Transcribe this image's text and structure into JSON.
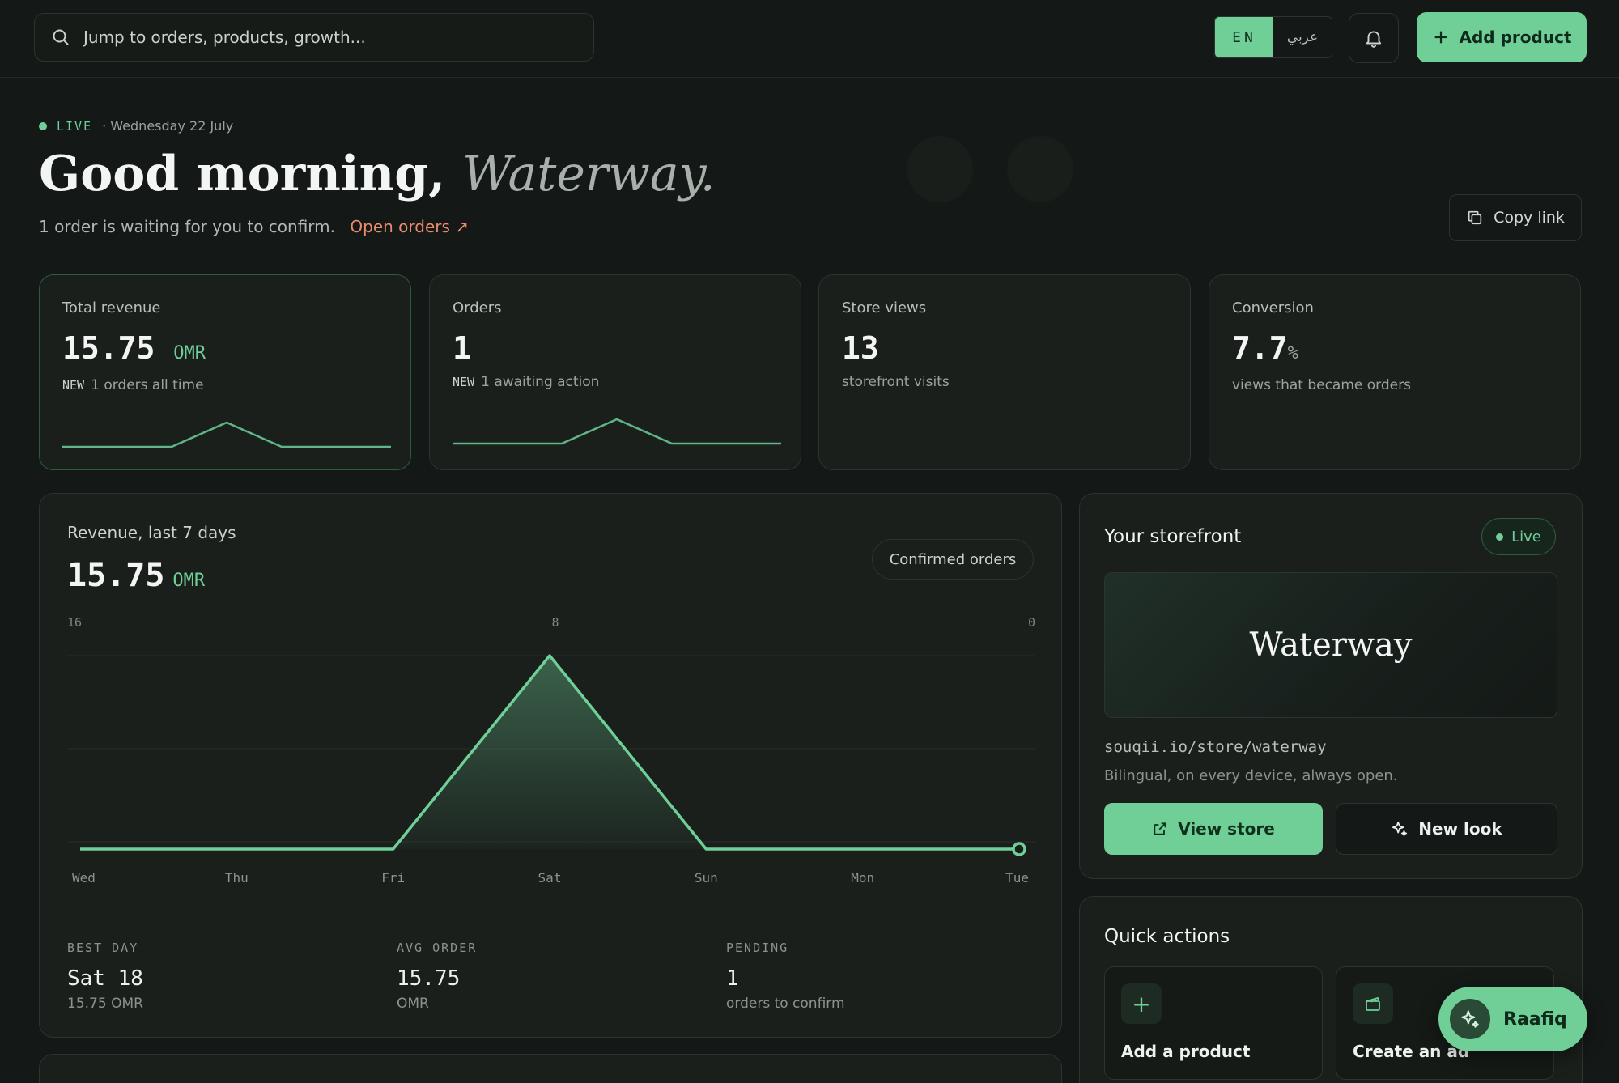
{
  "search": {
    "placeholder": "Jump to orders, products, growth..."
  },
  "lang": {
    "en": "EN",
    "ar": "عربي"
  },
  "topbar": {
    "add_product": "Add product"
  },
  "header": {
    "live": "LIVE",
    "date": "· Wednesday 22 July",
    "greeting_prefix": "Good morning,",
    "greeting_name": "Waterway.",
    "subline": "1 order is waiting for you to confirm.",
    "open_orders": "Open orders ↗",
    "copy_link": "Copy link"
  },
  "stats": [
    {
      "label": "Total revenue",
      "value": "15.75",
      "unit": "OMR",
      "tag": "NEW",
      "note": "1 orders all time"
    },
    {
      "label": "Orders",
      "value": "1",
      "tag": "NEW",
      "note": "1 awaiting action"
    },
    {
      "label": "Store views",
      "value": "13",
      "note": "storefront visits"
    },
    {
      "label": "Conversion",
      "value": "7.7",
      "unit": "%",
      "note": "views that became orders"
    }
  ],
  "revenue": {
    "title": "Revenue, last 7 days",
    "total": "15.75",
    "unit": "OMR",
    "filter": "Confirmed orders",
    "kpis": [
      {
        "key": "BEST DAY",
        "value": "Sat 18",
        "sub": "15.75 OMR"
      },
      {
        "key": "AVG ORDER",
        "value": "15.75",
        "sub": "OMR"
      },
      {
        "key": "PENDING",
        "value": "1",
        "sub": "orders to confirm"
      }
    ]
  },
  "chart_data": {
    "type": "area",
    "categories": [
      "Wed",
      "Thu",
      "Fri",
      "Sat",
      "Sun",
      "Mon",
      "Tue"
    ],
    "values": [
      0,
      0,
      0,
      15.75,
      0,
      0,
      0
    ],
    "ylim": [
      0,
      16
    ],
    "top_labels": [
      "16",
      "8",
      "0"
    ],
    "grid": true,
    "accent": "#6fcf97"
  },
  "storefront": {
    "title": "Your storefront",
    "badge": "Live",
    "name": "Waterway",
    "url": "souqii.io/store/waterway",
    "desc": "Bilingual, on every device, always open.",
    "view_store": "View store",
    "new_look": "New look"
  },
  "quick_actions": {
    "title": "Quick actions",
    "items": [
      {
        "label": "Add a product",
        "icon": "plus-icon"
      },
      {
        "label": "Create an ad",
        "icon": "clapper-icon"
      }
    ]
  },
  "assistant": {
    "label": "Raafiq"
  },
  "colors": {
    "accent": "#6fcf97",
    "link": "#e98b6d",
    "bg": "#141816",
    "card": "#1a1f1c"
  }
}
